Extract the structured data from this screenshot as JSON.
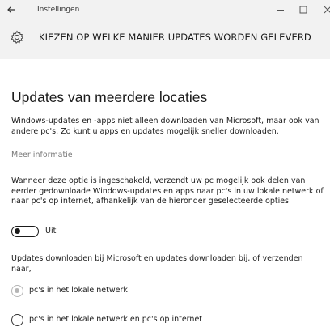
{
  "window": {
    "app_title": "Instellingen",
    "back_icon": "back-arrow-icon",
    "minimize_icon": "minimize-icon",
    "maximize_icon": "maximize-icon",
    "close_icon": "close-icon"
  },
  "header": {
    "icon": "gear-icon",
    "title": "KIEZEN OP WELKE MANIER UPDATES WORDEN GELEVERD"
  },
  "main": {
    "heading": "Updates van meerdere locaties",
    "intro": "Windows-updates en -apps niet alleen downloaden van Microsoft, maar ook van andere pc's. Zo kunt u apps en updates mogelijk sneller downloaden.",
    "more_info_link": "Meer informatie",
    "description": "Wanneer deze optie is ingeschakeld, verzendt uw pc mogelijk ook delen van eerder gedownloade Windows-updates en apps naar pc's in uw lokale netwerk of naar pc's op internet, afhankelijk van de hieronder geselecteerde opties.",
    "toggle": {
      "state_label": "Uit",
      "on": false
    },
    "options_intro": "Updates downloaden bij Microsoft en updates downloaden bij, of verzenden naar,",
    "options": [
      {
        "label": "pc's in het lokale netwerk",
        "selected": true,
        "disabled": true
      },
      {
        "label": "pc's in het lokale netwerk en pc's op internet",
        "selected": false,
        "disabled": true
      }
    ]
  },
  "colors": {
    "chrome_background": "#f2f2f2",
    "text": "#1a1a1a",
    "link": "#7a7a7a",
    "disabled_radio": "#b5b5b5"
  }
}
